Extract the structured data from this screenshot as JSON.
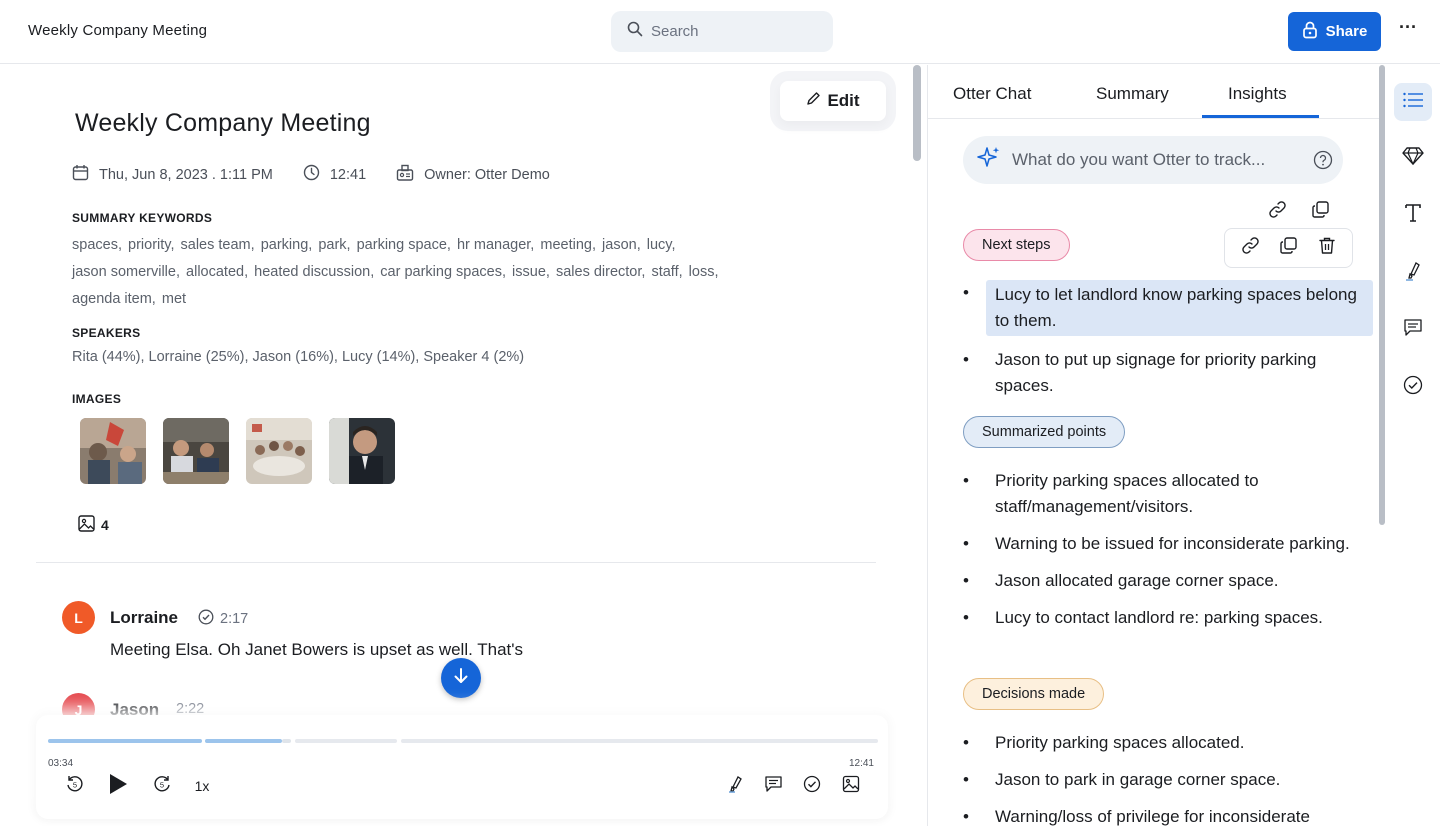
{
  "header": {
    "title": "Weekly Company Meeting",
    "search_placeholder": "Search",
    "share_label": "Share",
    "more_label": "···"
  },
  "meeting": {
    "edit_label": "Edit",
    "title": "Weekly Company Meeting",
    "date": "Thu, Jun 8, 2023 . 1:11 PM",
    "duration": "12:41",
    "owner": "Owner: Otter Demo",
    "keywords_label": "SUMMARY KEYWORDS",
    "keywords": [
      "spaces,",
      "priority,",
      "sales team,",
      "parking,",
      "park,",
      "parking space,",
      "hr manager,",
      "meeting,",
      "jason,",
      "lucy,",
      "jason somerville,",
      "allocated,",
      "heated discussion,",
      "car parking spaces,",
      "issue,",
      "sales director,",
      "staff,",
      "loss,",
      "agenda item,",
      "met"
    ],
    "speakers_label": "SPEAKERS",
    "speakers": "Rita (44%), Lorraine (25%), Jason (16%), Lucy (14%), Speaker 4 (2%)",
    "images_label": "IMAGES",
    "image_count": "4"
  },
  "transcript": [
    {
      "initial": "L",
      "speaker": "Lorraine",
      "time": "2:17",
      "text": "Meeting Elsa. Oh Janet Bowers is upset as well. That's",
      "color": "#f05a28"
    },
    {
      "initial": "J",
      "speaker": "Jason",
      "time": "2:22",
      "color": "#e5484d"
    }
  ],
  "player": {
    "current_time": "03:34",
    "total_time": "12:41",
    "speed": "1x",
    "progress": 0.28
  },
  "insights": {
    "tabs": [
      "Otter Chat",
      "Summary",
      "Insights"
    ],
    "active_tab": "Insights",
    "ask_placeholder": "What do you want Otter to track...",
    "sections": [
      {
        "tag": "Next steps",
        "items": [
          "Lucy to let landlord know parking spaces belong to them.",
          "Jason to put up signage for priority parking spaces."
        ]
      },
      {
        "tag": "Summarized points",
        "items": [
          "Priority parking spaces allocated to staff/management/visitors.",
          "Warning to be issued for inconsiderate parking.",
          "Jason allocated garage corner space.",
          "Lucy to contact landlord re: parking spaces."
        ]
      },
      {
        "tag": "Decisions made",
        "items": [
          "Priority parking spaces allocated.",
          "Jason to park in garage corner space.",
          "Warning/loss of privilege for inconsiderate"
        ]
      }
    ]
  },
  "colors": {
    "accent": "#1565d8",
    "next_steps_bg": "#fce4ec",
    "summarized_bg": "#e3ecf7",
    "decisions_bg": "#fdf0dd"
  }
}
